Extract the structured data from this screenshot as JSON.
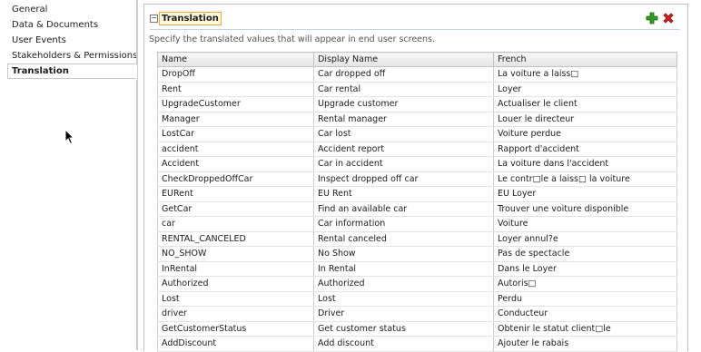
{
  "sidebar": {
    "items": [
      {
        "label": "General"
      },
      {
        "label": "Data & Documents"
      },
      {
        "label": "User Events"
      },
      {
        "label": "Stakeholders & Permissions"
      },
      {
        "label": "Translation"
      }
    ],
    "selected_index": 4
  },
  "section": {
    "title": "Translation",
    "description": "Specify the translated values that will appear in end user screens.",
    "add_icon": "plus-icon",
    "delete_icon": "x-icon"
  },
  "table": {
    "headers": [
      "Name",
      "Display Name",
      "French"
    ],
    "rows": [
      [
        "DropOff",
        "Car dropped off",
        "La voiture a laiss□"
      ],
      [
        "Rent",
        "Car rental",
        "Loyer"
      ],
      [
        "UpgradeCustomer",
        "Upgrade customer",
        "Actualiser le client"
      ],
      [
        "Manager",
        "Rental manager",
        "Louer le directeur"
      ],
      [
        "LostCar",
        "Car lost",
        "Voiture perdue"
      ],
      [
        "accident",
        "Accident report",
        "Rapport d'accident"
      ],
      [
        "Accident",
        "Car in accident",
        "La voiture dans l'accident"
      ],
      [
        "CheckDroppedOffCar",
        "Inspect dropped off car",
        "Le contr□le a laiss□ la voiture"
      ],
      [
        "EURent",
        "EU Rent",
        "EU Loyer"
      ],
      [
        "GetCar",
        "Find an available car",
        "Trouver une voiture disponible"
      ],
      [
        "car",
        "Car information",
        "Voiture"
      ],
      [
        "RENTAL_CANCELED",
        "Rental canceled",
        "Loyer annul?e"
      ],
      [
        "NO_SHOW",
        "No Show",
        "Pas de spectacle"
      ],
      [
        "InRental",
        "In Rental",
        "Dans le Loyer"
      ],
      [
        "Authorized",
        "Authorized",
        "Autoris□"
      ],
      [
        "Lost",
        "Lost",
        "Perdu"
      ],
      [
        "driver",
        "Driver",
        "Conducteur"
      ],
      [
        "GetCustomerStatus",
        "Get customer status",
        "Obtenir le statut client□le"
      ],
      [
        "AddDiscount",
        "Add discount",
        "Ajouter le rabais"
      ]
    ]
  },
  "colors": {
    "add": "#2e9c1f",
    "delete": "#d0201a",
    "title_border": "#e5a940",
    "title_bg": "#fff7d9"
  }
}
